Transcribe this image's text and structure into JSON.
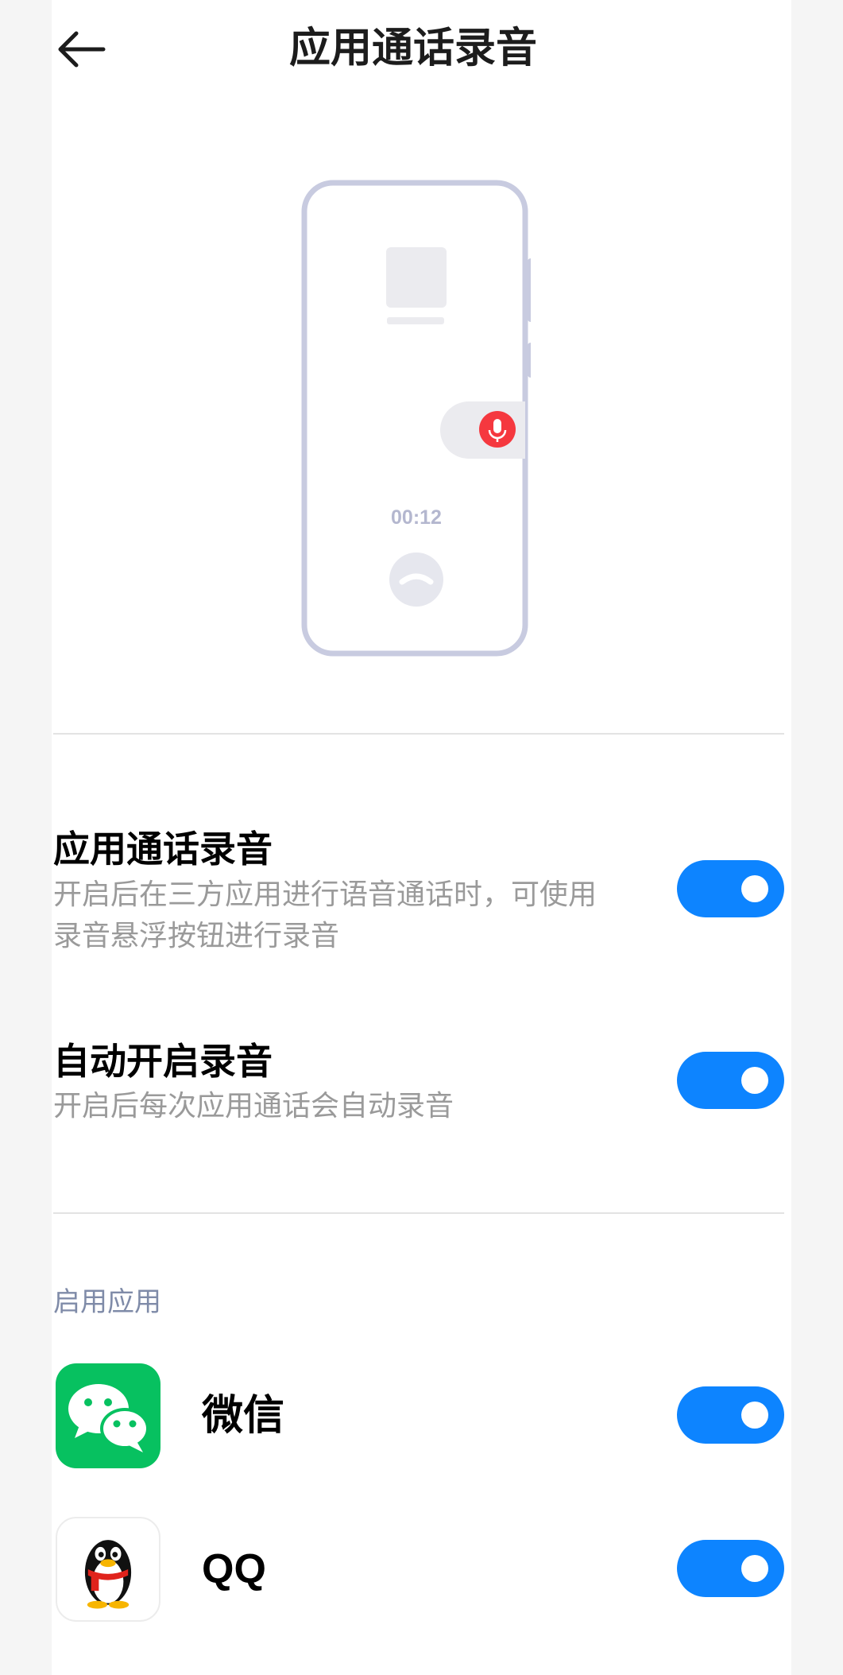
{
  "header": {
    "title": "应用通话录音"
  },
  "illustration": {
    "timer": "00:12"
  },
  "settings": [
    {
      "title": "应用通话录音",
      "desc_line1": "开启后在三方应用进行语音通话时，可使用",
      "desc_line2": "录音悬浮按钮进行录音",
      "enabled": true
    },
    {
      "title": "自动开启录音",
      "desc_line1": "开启后每次应用通话会自动录音",
      "enabled": true
    }
  ],
  "enabled_apps": {
    "label": "启用应用",
    "items": [
      {
        "name": "微信",
        "icon": "wechat-icon",
        "enabled": true
      },
      {
        "name": "QQ",
        "icon": "qq-icon",
        "enabled": true
      }
    ]
  },
  "colors": {
    "accent": "#0d84ff",
    "record": "#f5383f",
    "wechat": "#07c160",
    "phone_outline": "#c8cbe0"
  }
}
